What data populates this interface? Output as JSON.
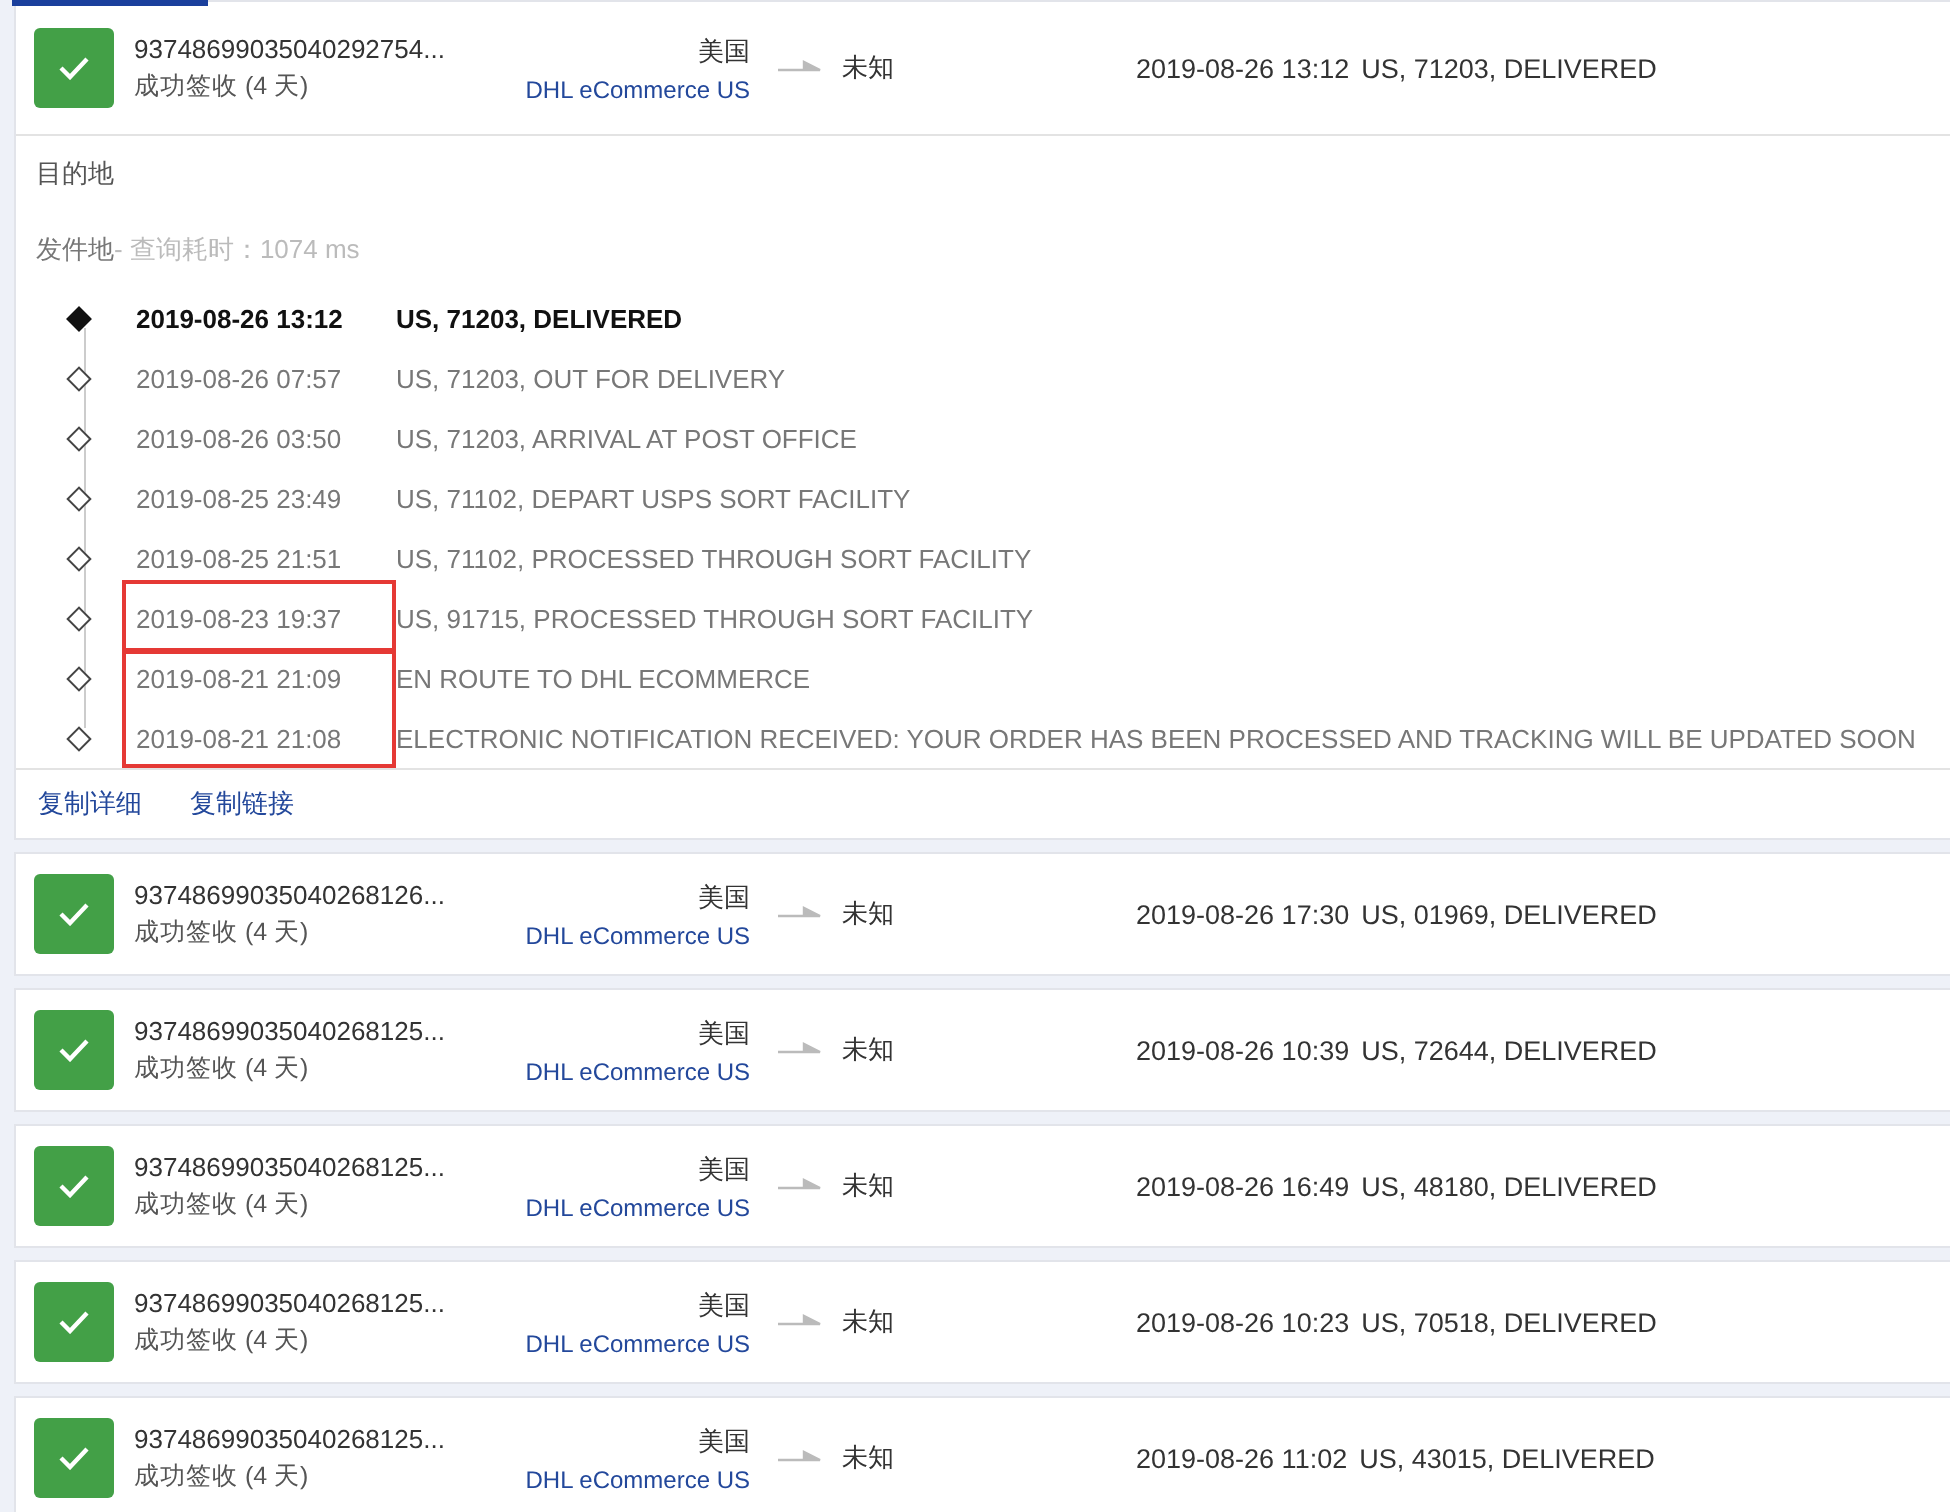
{
  "shipments": [
    {
      "number": "93748699035040292754...",
      "status": "成功签收 (4 天)",
      "delivered": true,
      "origin": "美国",
      "carrier": "DHL eCommerce US",
      "destination": "未知",
      "latest_time": "2019-08-26 13:12",
      "latest_event": "US, 71203, DELIVERED",
      "expanded": true,
      "detail": {
        "destination_label": "目的地",
        "origin_label": "发件地",
        "query_time": " - 查询耗时：1074 ms",
        "groups": [
          {
            "marked": false,
            "events": [
              {
                "time": "2019-08-26 13:12",
                "event": "US, 71203, DELIVERED",
                "latest": true
              },
              {
                "time": "2019-08-26 07:57",
                "event": "US, 71203, OUT FOR DELIVERY",
                "latest": false
              },
              {
                "time": "2019-08-26 03:50",
                "event": "US, 71203, ARRIVAL AT POST OFFICE",
                "latest": false
              },
              {
                "time": "2019-08-25 23:49",
                "event": "US, 71102, DEPART USPS SORT FACILITY",
                "latest": false
              },
              {
                "time": "2019-08-25 21:51",
                "event": "US, 71102, PROCESSED THROUGH SORT FACILITY",
                "latest": false
              }
            ]
          },
          {
            "marked": true,
            "events": [
              {
                "time": "2019-08-23 19:37",
                "event": "US, 91715, PROCESSED THROUGH SORT FACILITY",
                "latest": false
              }
            ]
          },
          {
            "marked": true,
            "events": [
              {
                "time": "2019-08-21 21:09",
                "event": "EN ROUTE TO DHL ECOMMERCE",
                "latest": false
              },
              {
                "time": "2019-08-21 21:08",
                "event": "ELECTRONIC NOTIFICATION RECEIVED: YOUR ORDER HAS BEEN PROCESSED AND TRACKING WILL BE UPDATED SOON",
                "latest": false
              }
            ]
          }
        ],
        "links": [
          "复制详细",
          "复制链接"
        ]
      }
    },
    {
      "number": "93748699035040268126...",
      "status": "成功签收 (4 天)",
      "delivered": true,
      "origin": "美国",
      "carrier": "DHL eCommerce US",
      "destination": "未知",
      "latest_time": "2019-08-26 17:30",
      "latest_event": "US, 01969, DELIVERED",
      "expanded": false
    },
    {
      "number": "93748699035040268125...",
      "status": "成功签收 (4 天)",
      "delivered": true,
      "origin": "美国",
      "carrier": "DHL eCommerce US",
      "destination": "未知",
      "latest_time": "2019-08-26 10:39",
      "latest_event": "US, 72644, DELIVERED",
      "expanded": false
    },
    {
      "number": "93748699035040268125...",
      "status": "成功签收 (4 天)",
      "delivered": true,
      "origin": "美国",
      "carrier": "DHL eCommerce US",
      "destination": "未知",
      "latest_time": "2019-08-26 16:49",
      "latest_event": "US, 48180, DELIVERED",
      "expanded": false
    },
    {
      "number": "93748699035040268125...",
      "status": "成功签收 (4 天)",
      "delivered": true,
      "origin": "美国",
      "carrier": "DHL eCommerce US",
      "destination": "未知",
      "latest_time": "2019-08-26 10:23",
      "latest_event": "US, 70518, DELIVERED",
      "expanded": false
    },
    {
      "number": "93748699035040268125...",
      "status": "成功签收 (4 天)",
      "delivered": true,
      "origin": "美国",
      "carrier": "DHL eCommerce US",
      "destination": "未知",
      "latest_time": "2019-08-26 11:02",
      "latest_event": "US, 43015, DELIVERED",
      "expanded": false
    }
  ]
}
